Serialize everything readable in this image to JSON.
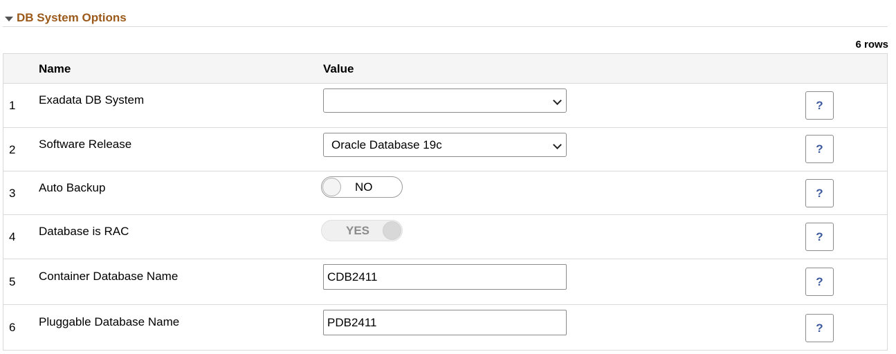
{
  "section": {
    "title": "DB System Options",
    "row_count": "6 rows"
  },
  "grid": {
    "columns": {
      "name": "Name",
      "value": "Value"
    },
    "rows": [
      {
        "num": "1",
        "name": "Exadata DB System",
        "value_type": "select",
        "value": ""
      },
      {
        "num": "2",
        "name": "Software Release",
        "value_type": "select",
        "value": "Oracle Database 19c"
      },
      {
        "num": "3",
        "name": "Auto Backup",
        "value_type": "toggle",
        "value": "NO"
      },
      {
        "num": "4",
        "name": "Database is RAC",
        "value_type": "toggle",
        "value": "YES"
      },
      {
        "num": "5",
        "name": "Container Database Name",
        "value_type": "text",
        "value": "CDB2411"
      },
      {
        "num": "6",
        "name": "Pluggable Database Name",
        "value_type": "text",
        "value": "PDB2411"
      }
    ],
    "help_glyph": "?"
  },
  "colors": {
    "section_title": "#9b5a1a",
    "help_icon": "#3d5a9e",
    "border": "#d9d9d9",
    "header_bg": "#f5f5f5"
  }
}
